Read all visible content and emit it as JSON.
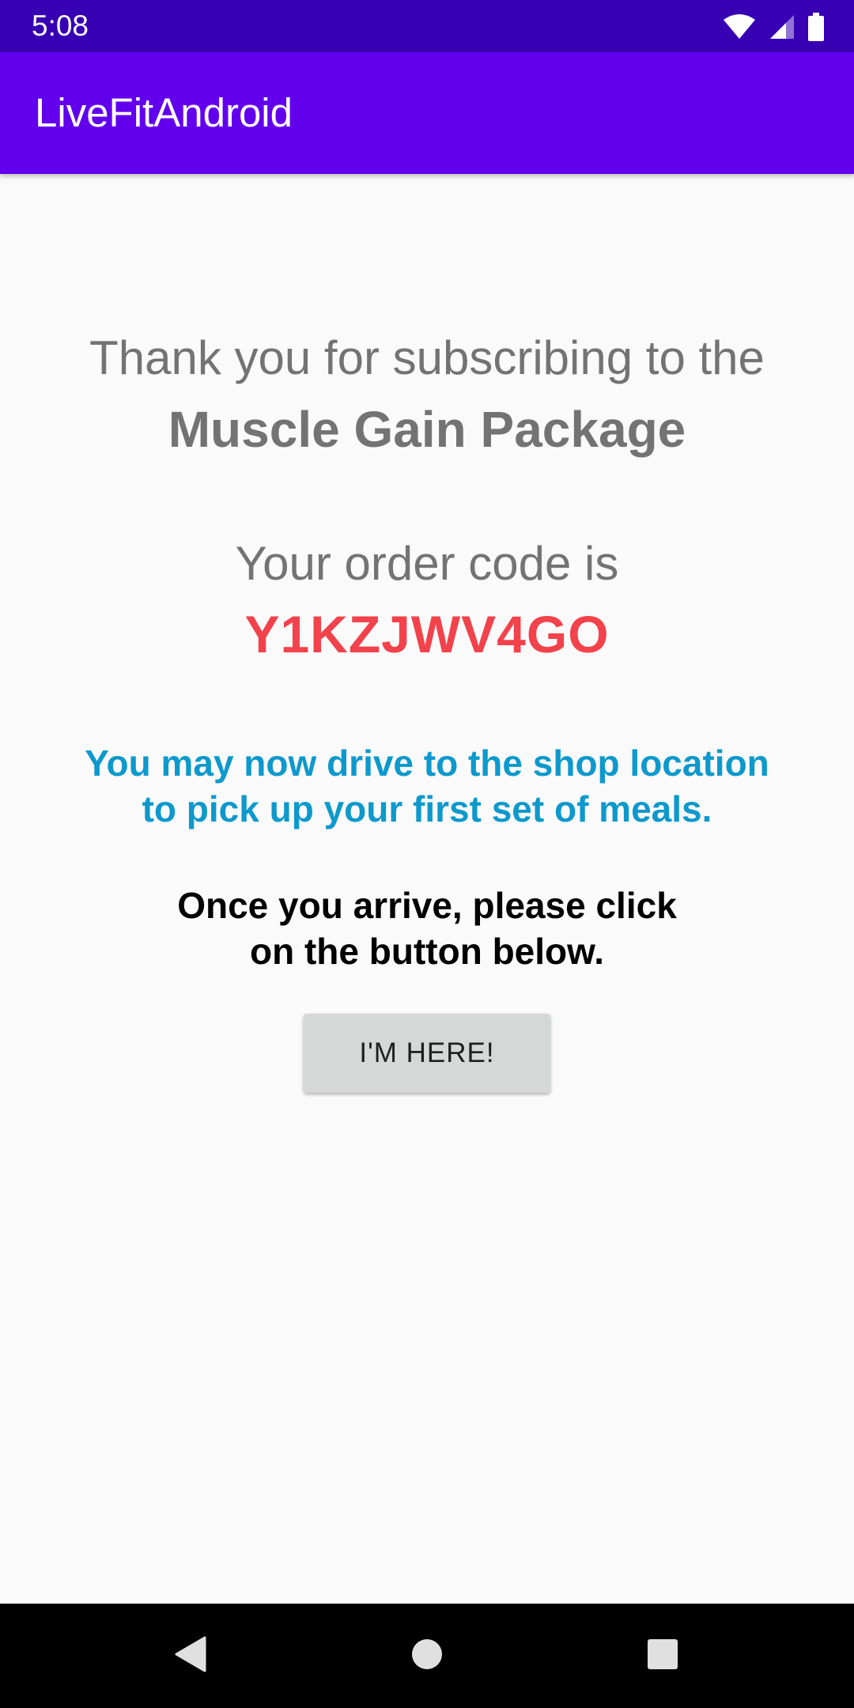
{
  "status_bar": {
    "time": "5:08",
    "icons": [
      "wifi-icon",
      "cell-signal-icon",
      "battery-icon"
    ]
  },
  "app_bar": {
    "title": "LiveFitAndroid"
  },
  "main": {
    "thanks_line": "Thank you for subscribing to the",
    "package_name": "Muscle Gain Package",
    "order_label": "Your order code is",
    "order_code": "Y1KZJWV4GO",
    "drive_line_1": "You may now drive to the shop location",
    "drive_line_2": "to pick up your first set of meals.",
    "arrive_line_1": "Once you arrive, please click",
    "arrive_line_2": "on the button below.",
    "button_label": "I'M HERE!"
  },
  "nav_bar": {
    "icons": [
      "back-icon",
      "home-icon",
      "recents-icon"
    ]
  },
  "colors": {
    "status_bar": "#3700B3",
    "app_bar": "#6200EE",
    "order_code": "#F2424B",
    "drive_text": "#0D99CC",
    "body_text": "#737373"
  }
}
